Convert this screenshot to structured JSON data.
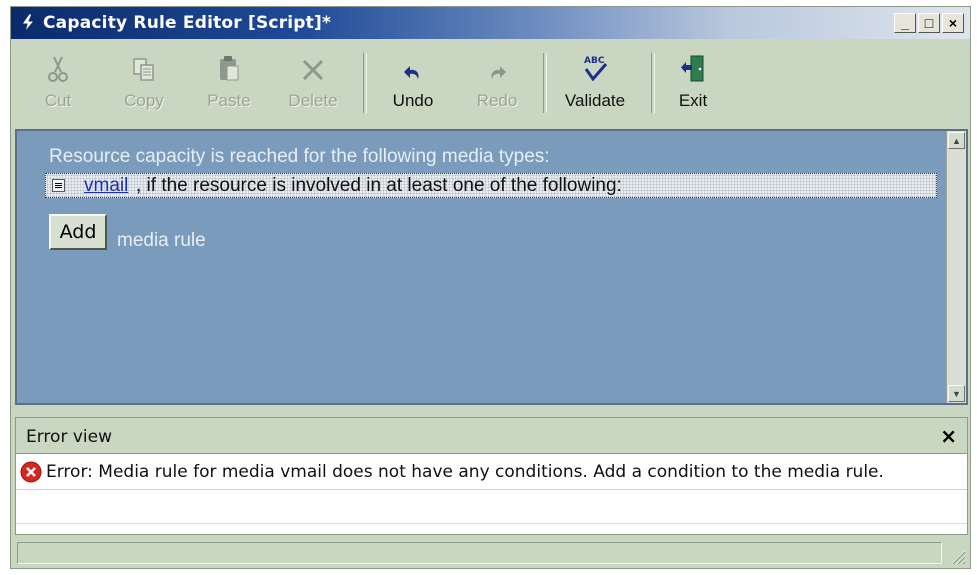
{
  "window": {
    "title": "Capacity Rule Editor [Script]*",
    "controls": {
      "minimize": "_",
      "maximize": "□",
      "close": "×"
    }
  },
  "toolbar": {
    "items": [
      {
        "label": "Cut",
        "icon": "scissors-icon",
        "enabled": false
      },
      {
        "label": "Copy",
        "icon": "copy-icon",
        "enabled": false
      },
      {
        "label": "Paste",
        "icon": "paste-icon",
        "enabled": false
      },
      {
        "label": "Delete",
        "icon": "delete-x-icon",
        "enabled": false
      },
      {
        "label": "Undo",
        "icon": "undo-arrow-icon",
        "enabled": true
      },
      {
        "label": "Redo",
        "icon": "redo-arrow-icon",
        "enabled": false
      },
      {
        "label": "Validate",
        "icon": "spellcheck-abc-icon",
        "enabled": true
      },
      {
        "label": "Exit",
        "icon": "exit-door-icon",
        "enabled": true
      }
    ]
  },
  "editor": {
    "heading": "Resource capacity is reached for the following media types:",
    "rule": {
      "media": "vmail",
      "text": ", if the resource is involved in at least one of the following:"
    },
    "add_button": "Add",
    "add_text": "media rule"
  },
  "error_view": {
    "title": "Error view",
    "close": "×",
    "errors": [
      {
        "message": "Error: Media rule for media vmail does not have any conditions. Add a condition to the media rule."
      }
    ]
  },
  "colors": {
    "editor_bg": "#7b9bbd",
    "chrome_bg": "#c9d6c2",
    "link": "#1b2fb5",
    "error_icon": "#d7261e"
  }
}
